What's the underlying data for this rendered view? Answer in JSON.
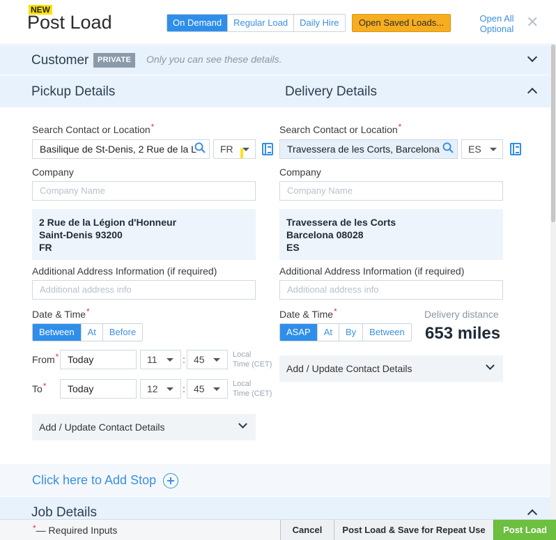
{
  "header": {
    "new_badge": "NEW",
    "title": "Post Load",
    "load_types": [
      "On Demand",
      "Regular Load",
      "Daily Hire"
    ],
    "active_load_type": "On Demand",
    "open_saved_label": "Open Saved Loads...",
    "open_all_label_line1": "Open All",
    "open_all_label_line2": "Optional",
    "close_glyph": "✕"
  },
  "customer": {
    "title": "Customer",
    "badge": "PRIVATE",
    "note": "Only you can see these details."
  },
  "pickup": {
    "title": "Pickup Details",
    "search_label": "Search Contact or Location",
    "search_value": "Basilique de St-Denis, 2 Rue de la L",
    "country": "FR",
    "company_label": "Company",
    "company_placeholder": "Company Name",
    "address_line1": "2 Rue de la Légion d'Honneur",
    "address_line2": "Saint-Denis 93200",
    "address_line3": "FR",
    "additional_label": "Additional Address Information (if required)",
    "additional_placeholder": "Additional address info",
    "datetime_label": "Date & Time",
    "datetime_options": [
      "Between",
      "At",
      "Before"
    ],
    "datetime_active": "Between",
    "from_label": "From",
    "from_day": "Today",
    "from_hour": "11",
    "from_minute": "45",
    "to_label": "To",
    "to_day": "Today",
    "to_hour": "12",
    "to_minute": "45",
    "timezone_note_line1": "Local",
    "timezone_note_line2": "Time (CET)",
    "contact_label": "Add / Update Contact Details"
  },
  "delivery": {
    "title": "Delivery Details",
    "search_label": "Search Contact or Location",
    "search_value": "Travessera de les Corts, Barcelona",
    "country": "ES",
    "company_label": "Company",
    "company_placeholder": "Company Name",
    "address_line1": "Travessera de les Corts",
    "address_line2": "Barcelona 08028",
    "address_line3": "ES",
    "additional_label": "Additional Address Information (if required)",
    "additional_placeholder": "Additional address info",
    "datetime_label": "Date & Time",
    "datetime_options": [
      "ASAP",
      "At",
      "By",
      "Between"
    ],
    "datetime_active": "ASAP",
    "distance_label": "Delivery distance",
    "distance_value": "653 miles",
    "contact_label": "Add / Update Contact Details"
  },
  "add_stop_label": "Click here to Add Stop",
  "job_details_title": "Job Details",
  "footer": {
    "required_star": "*",
    "required_note": "— Required Inputs",
    "cancel_label": "Cancel",
    "save_repeat_label": "Post Load & Save for Repeat Use",
    "post_label": "Post Load"
  },
  "colors": {
    "accent": "#2f8ee9",
    "saved_button": "#f6ad1f",
    "post_button": "#6cbf3f",
    "band": "#e8f2fc",
    "required": "#e5333b"
  },
  "icons": [
    "search-icon",
    "address-book-icon",
    "chevron-down-icon",
    "chevron-up-icon",
    "plus-circle-icon",
    "close-icon"
  ]
}
